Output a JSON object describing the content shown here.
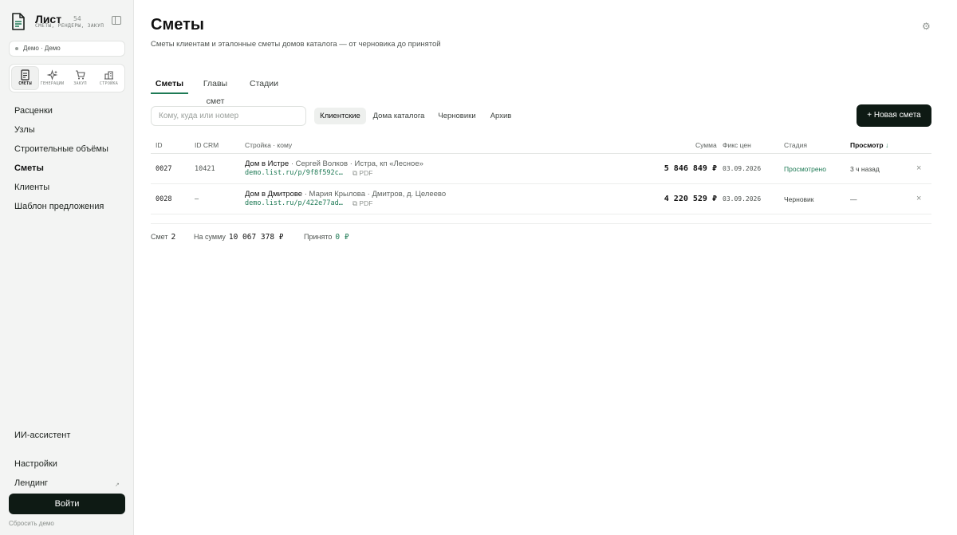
{
  "brand": {
    "title": "Лист",
    "version": "54",
    "subtitle": "СМЕТЫ, РЕНДЕРЫ, ЗАКУП"
  },
  "workspace": {
    "label": "Демо · Демо"
  },
  "modes": [
    {
      "label": "СМЕТЫ",
      "icon": "document-icon"
    },
    {
      "label": "ГЕНЕРАЦИИ",
      "icon": "sparkle-icon"
    },
    {
      "label": "ЗАКУП",
      "icon": "cart-icon"
    },
    {
      "label": "СТРОЙКА",
      "icon": "building-icon"
    }
  ],
  "nav": {
    "items": [
      {
        "label": "Расценки"
      },
      {
        "label": "Узлы"
      },
      {
        "label": "Строительные объёмы"
      },
      {
        "label": "Сметы",
        "active": true
      },
      {
        "label": "Клиенты"
      },
      {
        "label": "Шаблон предложения"
      }
    ]
  },
  "sidebar_bottom": {
    "assistant": "ИИ-ассистент",
    "settings": "Настройки",
    "landing": "Лендинг",
    "landing_icon": "↗",
    "login": "Войти",
    "reset": "Сбросить демо"
  },
  "page": {
    "title": "Сметы",
    "subtitle": "Сметы клиентам и эталонные сметы домов каталога — от черновика до принятой",
    "settings_icon": "⚙"
  },
  "tabs": [
    {
      "label": "Сметы",
      "active": true
    },
    {
      "label": "Главы смет"
    },
    {
      "label": "Стадии"
    }
  ],
  "search": {
    "placeholder": "Кому, куда или номер",
    "value": ""
  },
  "filters": [
    {
      "label": "Клиентские",
      "active": true
    },
    {
      "label": "Дома каталога"
    },
    {
      "label": "Черновики"
    },
    {
      "label": "Архив"
    }
  ],
  "new_button": {
    "label": "+ Новая смета"
  },
  "table": {
    "columns": {
      "id": "ID",
      "crm": "ID CRM",
      "object": "Стройка · кому",
      "sum": "Сумма",
      "fix": "Фикс цен",
      "stage": "Стадия",
      "view": "Просмотр",
      "view_arrow": "↓"
    },
    "rows": [
      {
        "id": "0027",
        "crm": "10421",
        "name": "Дом в Истре",
        "meta": " · Сергей Волков · Истра, кп «Лесное»",
        "link": "demo.list.ru/p/9f8f592c…",
        "pdf": "⧉ PDF",
        "sum": "5 846 849 ₽",
        "fix": "03.09.2026",
        "stage": "Просмотрено",
        "view": "3 ч назад",
        "delete": "×"
      },
      {
        "id": "0028",
        "crm": "–",
        "name": "Дом в Дмитрове",
        "meta": " · Мария Крылова · Дмитров, д. Целеево",
        "link": "demo.list.ru/p/422e77ad…",
        "pdf": "⧉ PDF",
        "sum": "4 220 529 ₽",
        "fix": "03.09.2026",
        "stage": "Черновик",
        "view": "—",
        "delete": "×"
      }
    ]
  },
  "summary": {
    "count_label": "Смет",
    "count": "2",
    "total_label": "На сумму",
    "total": "10 067 378 ₽",
    "accepted_label": "Принято",
    "accepted": "0 ₽"
  },
  "colors": {
    "accent": "#1e7a55",
    "dark": "#0e1a14",
    "sidebar_bg": "#f3f4f3"
  }
}
